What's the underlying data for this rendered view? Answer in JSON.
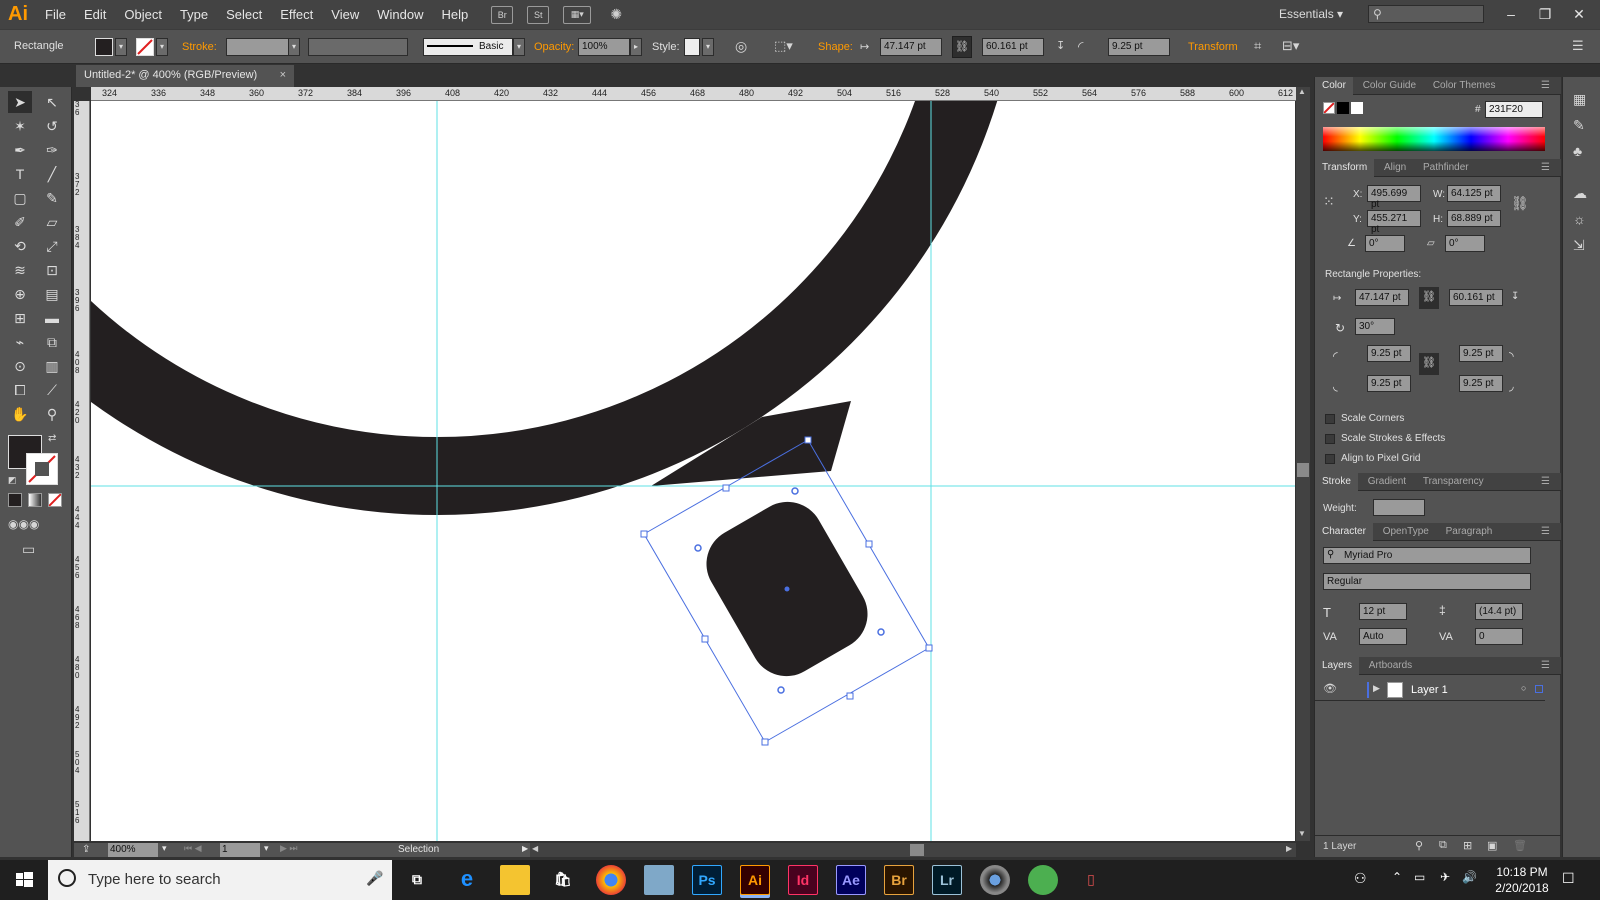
{
  "app": {
    "logo": "Ai",
    "workspace": "Essentials ▾"
  },
  "menu": [
    "File",
    "Edit",
    "Object",
    "Type",
    "Select",
    "Effect",
    "View",
    "Window",
    "Help"
  ],
  "menubar_icons": [
    "Br",
    "St"
  ],
  "window_buttons": [
    "–",
    "❐",
    "✕"
  ],
  "controlbar": {
    "object_type": "Rectangle",
    "stroke_label": "Stroke:",
    "brush": "Basic",
    "opacity_label": "Opacity:",
    "opacity": "100%",
    "style_label": "Style:",
    "shape_label": "Shape:",
    "width": "47.147 pt",
    "height": "60.161 pt",
    "corner": "9.25 pt",
    "transform_label": "Transform"
  },
  "document": {
    "tab_title": "Untitled-2* @ 400% (RGB/Preview)",
    "close": "×"
  },
  "ruler_top": [
    "324",
    "336",
    "348",
    "360",
    "372",
    "384",
    "396",
    "408",
    "420",
    "432",
    "444",
    "456",
    "468",
    "480",
    "492",
    "504",
    "516",
    "528",
    "540",
    "552",
    "564",
    "576",
    "588",
    "600",
    "612"
  ],
  "ruler_left": [
    "3 6",
    "3 7 2",
    "3 8 4",
    "3 9 6",
    "4 0 8",
    "4 2 0",
    "4 3 2",
    "4 4 4",
    "4 5 6",
    "4 6 8",
    "4 8 0",
    "4 9 2",
    "5 0 4",
    "5 1 6"
  ],
  "status": {
    "zoom": "400%",
    "artboard": "1",
    "tool": "Selection"
  },
  "color_panel": {
    "tabs": [
      "Color",
      "Color Guide",
      "Color Themes"
    ],
    "hex_label": "#",
    "hex": "231F20"
  },
  "transform_panel": {
    "tabs": [
      "Transform",
      "Align",
      "Pathfinder"
    ],
    "x_label": "X:",
    "x": "495.699 pt",
    "y_label": "Y:",
    "y": "455.271 pt",
    "w_label": "W:",
    "w": "64.125 pt",
    "h_label": "H:",
    "h": "68.889 pt",
    "angle": "0°",
    "shear": "0°",
    "rect_props_label": "Rectangle Properties:",
    "rect_w": "47.147 pt",
    "rect_h": "60.161 pt",
    "rotation": "30°",
    "corners": [
      "9.25 pt",
      "9.25 pt",
      "9.25 pt",
      "9.25 pt"
    ],
    "checks": [
      "Scale Corners",
      "Scale Strokes & Effects",
      "Align to Pixel Grid"
    ]
  },
  "stroke_panel": {
    "tabs": [
      "Stroke",
      "Gradient",
      "Transparency"
    ],
    "weight_label": "Weight:"
  },
  "character_panel": {
    "tabs": [
      "Character",
      "OpenType",
      "Paragraph"
    ],
    "font": "Myriad Pro",
    "style": "Regular",
    "size": "12 pt",
    "leading": "(14.4 pt)",
    "kerning": "Auto",
    "tracking": "0"
  },
  "layers_panel": {
    "tabs": [
      "Layers",
      "Artboards"
    ],
    "layer_name": "Layer 1",
    "count": "1 Layer"
  },
  "taskbar": {
    "search_placeholder": "Type here to search",
    "apps": [
      "Ps",
      "Ai",
      "Id",
      "Ae",
      "Br",
      "Lr"
    ],
    "time": "10:18 PM",
    "date": "2/20/2018"
  },
  "colors": {
    "fill": "#231F20",
    "guide": "#5fe1e5",
    "selection": "#4a6fe0",
    "accent": "#ff9a00"
  }
}
